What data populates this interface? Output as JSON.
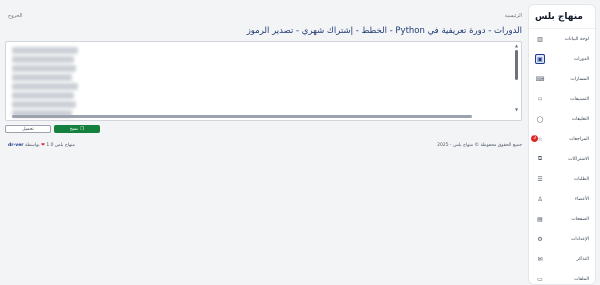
{
  "brand": "منهاج بلس",
  "sidebar": {
    "items": [
      {
        "label": "لوحة البيانات",
        "icon": "chart-icon"
      },
      {
        "label": "الدورات",
        "icon": "book-icon",
        "active": true
      },
      {
        "label": "المسارات",
        "icon": "code-icon"
      },
      {
        "label": "التصنيفات",
        "icon": "bookmark-icon"
      },
      {
        "label": "التعليقات",
        "icon": "comment-icon"
      },
      {
        "label": "المراجعات",
        "icon": "star-icon",
        "badge": "3"
      },
      {
        "label": "الاشتراكات",
        "icon": "ticket-icon"
      },
      {
        "label": "الطلبات",
        "icon": "list-icon"
      },
      {
        "label": "الأعضاء",
        "icon": "user-icon"
      },
      {
        "label": "الصفحات",
        "icon": "page-icon"
      },
      {
        "label": "الإعدادات",
        "icon": "gear-icon"
      },
      {
        "label": "التذاكر",
        "icon": "ticket2-icon"
      },
      {
        "label": "الملفات",
        "icon": "file-icon"
      }
    ]
  },
  "header": {
    "breadcrumb": "الرئيسية",
    "logout": "الخروج"
  },
  "page_title": "الدورات - دورة تعريفية في Python - الخطط - إشتراك شهري - تصدير الرموز",
  "actions": {
    "copy_label": "نسخ",
    "download_label": "تحميل"
  },
  "footer": {
    "copyright": "جميع الحقوق محفوظة © منهاج بلس - 2025",
    "version_prefix": "منهاج بلس 1.0",
    "by_label": "بواسطة",
    "author": "dr-ver"
  },
  "colors": {
    "primary": "#1f3b73",
    "copy_button": "#15803d",
    "badge": "#dc2626"
  }
}
